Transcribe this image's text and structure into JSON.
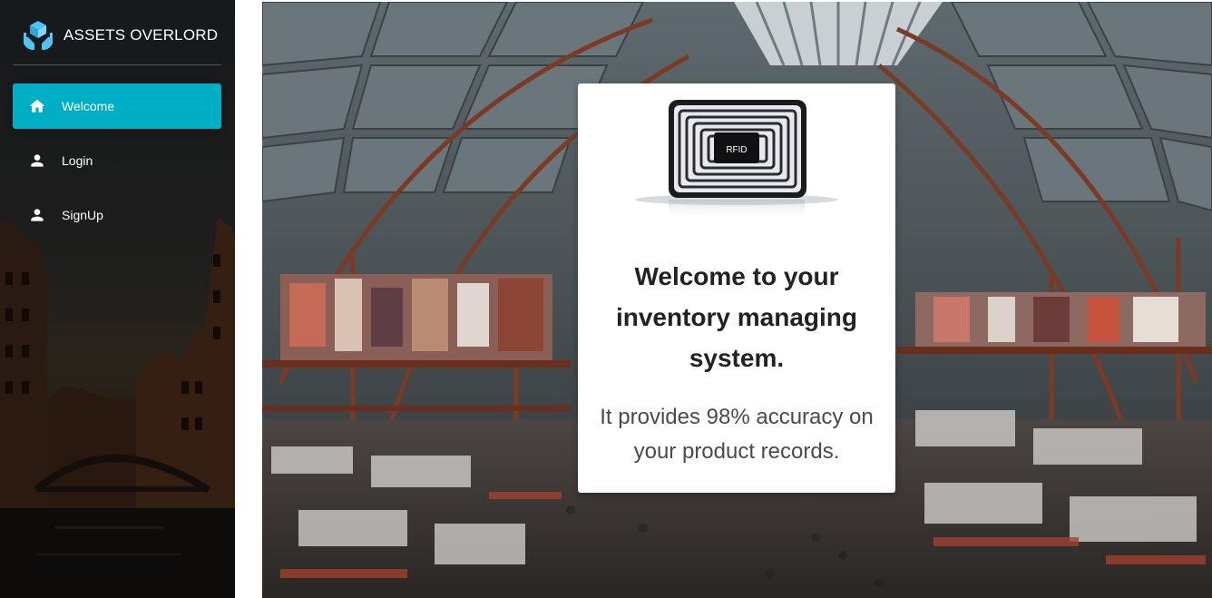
{
  "brand": {
    "title": "ASSETS OVERLORD",
    "logo_icon": "hands-box-logo-icon",
    "accent": "#00aec5"
  },
  "sidebar": {
    "items": [
      {
        "label": "Welcome",
        "icon": "home-icon",
        "active": true
      },
      {
        "label": "Login",
        "icon": "person-icon",
        "active": false
      },
      {
        "label": "SignUp",
        "icon": "person-icon",
        "active": false
      }
    ]
  },
  "card": {
    "image_label": "RFID",
    "title": "Welcome to your inventory managing system.",
    "text": "It provides 98% accuracy on your product records."
  },
  "colors": {
    "active_nav": "#00aec5",
    "sidebar_bg": "#1e2124",
    "card_bg": "#ffffff",
    "title_text": "#222222",
    "body_text": "#4a4a4a"
  }
}
